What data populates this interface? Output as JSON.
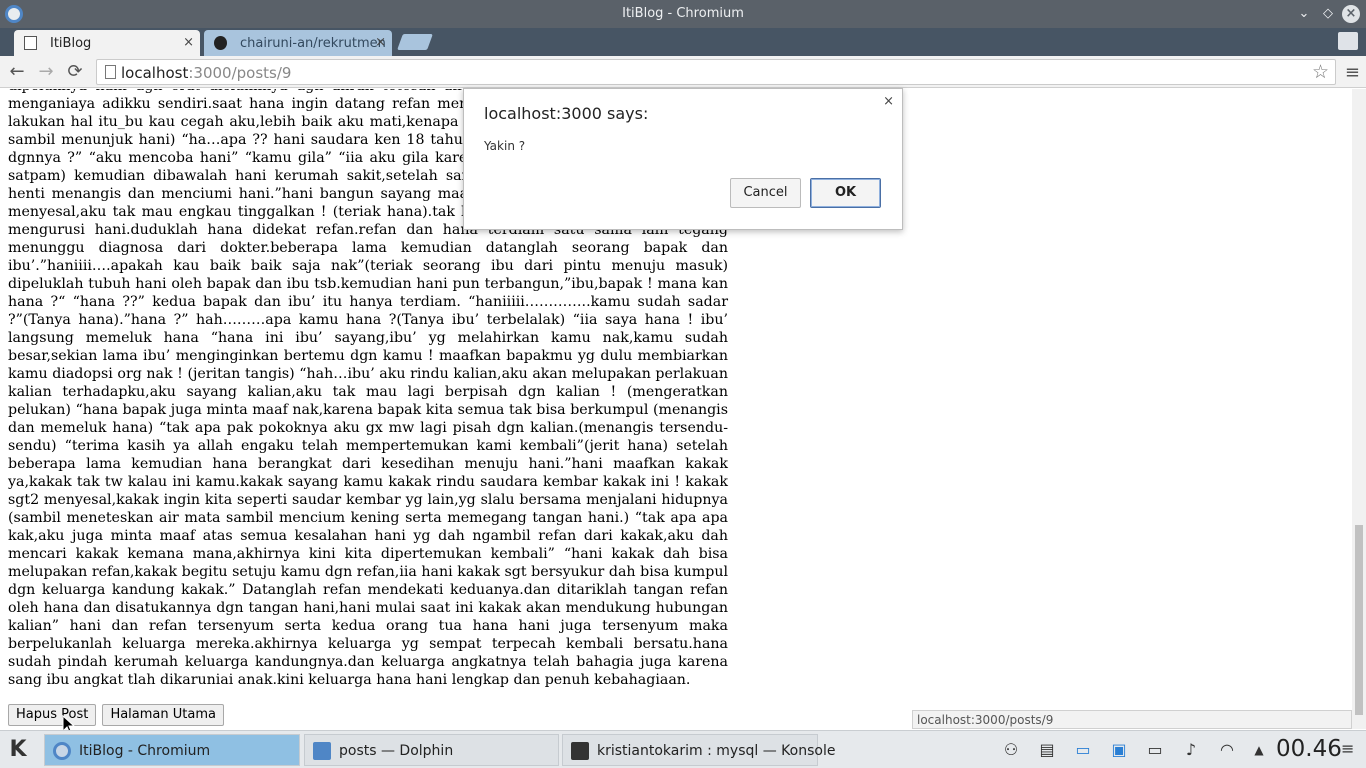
{
  "window": {
    "title": "ItiBlog - Chromium"
  },
  "tabs": [
    {
      "label": "ItiBlog",
      "close": "×"
    },
    {
      "label": "chairuni-an/rekrutmen",
      "close": "×"
    }
  ],
  "toolbar": {
    "back": "←",
    "forward": "→",
    "reload": "⟳",
    "url_host": "localhost",
    "url_path": ":3000/posts/9",
    "star": "☆",
    "menu": "≡"
  },
  "article": {
    "body": "dipeluknya hani dgn erat diciuminya dgn aliran tetesan air mata yg harus mati saja,aku tlah menganiaya adikku sendiri.saat hana ingin datang refan mencegahnya.”ada apa hana ? jgn kau lakukan hal itu_bu kau cegah aku,lebih baik aku mati,kenapa kau tak cerita kala ?”(memberontak sambil menunjuk hani) “ha…apa ?? hani saudara ken 18 tahun terpisahkan” “apa yg kau lakukan dgnnya ?” “aku mencoba hani” “kamu gila” “iia aku gila karena mu” “sudah sudah jgn bertengk satpam) kemudian dibawalah hani kerumah sakit,setelah sampai dirumah sakit hana tak henti henti menangis dan menciumi hani.”hani bangun sayang maafkan kakakmu ini sayang ! aku sgt menyesal,aku tak mau engkau tinggalkan ! (teriak hana).tak lama kemudian datanglah dokter yg mengurusi hani.duduklah hana didekat refan.refan dan hana terdiam satu sama lain tegang menunggu diagnosa dari dokter.beberapa lama kemudian datanglah seorang bapak dan ibu’.”haniiii….apakah kau baik baik saja nak”(teriak seorang ibu dari pintu menuju masuk) dipeluklah tubuh hani oleh bapak dan ibu tsb.kemudian hani pun terbangun,”ibu,bapak ! mana kan hana ?“ “hana ??” kedua bapak dan ibu’ itu hanya terdiam. “haniiiii…………..kamu sudah sadar ?”(Tanya hana).”hana ?” hah………apa kamu hana ?(Tanya ibu’ terbelalak) “iia saya hana ! ibu’ langsung memeluk hana “hana ini ibu’ sayang,ibu’ yg melahirkan kamu nak,kamu sudah besar,sekian lama ibu’ menginginkan bertemu dgn kamu ! maafkan bapakmu yg dulu membiarkan kamu diadopsi org nak ! (jeritan tangis) “hah…ibu’ aku rindu kalian,aku akan melupakan perlakuan kalian terhadapku,aku sayang kalian,aku tak mau lagi berpisah dgn kalian ! (mengeratkan pelukan) “hana bapak juga minta maaf nak,karena bapak kita semua tak bisa berkumpul (menangis dan memeluk hana) “tak apa pak pokoknya aku gx mw lagi pisah dgn kalian.(menangis tersendu-sendu) “terima kasih ya allah engaku telah mempertemukan kami kembali”(jerit hana) setelah beberapa lama kemudian hana berangkat dari kesedihan menuju hani.”hani maafkan kakak ya,kakak tak tw kalau ini kamu.kakak sayang kamu kakak rindu saudara kembar kakak ini ! kakak sgt2 menyesal,kakak ingin kita seperti saudar kembar yg lain,yg slalu bersama menjalani hidupnya (sambil meneteskan air mata sambil mencium kening serta memegang tangan hani.) “tak apa apa kak,aku juga minta maaf atas semua kesalahan hani yg dah ngambil refan dari kakak,aku dah mencari kakak kemana mana,akhirnya kini kita dipertemukan kembali” “hani kakak dah bisa melupakan refan,kakak begitu setuju kamu dgn refan,iia hani kakak sgt bersyukur dah bisa kumpul dgn keluarga kandung kakak.” Datanglah refan mendekati keduanya.dan ditariklah tangan refan oleh hana dan disatukannya dgn tangan hani,hani mulai saat ini kakak akan mendukung hubungan kalian” hani dan refan tersenyum serta kedua orang tua hana hani juga tersenyum maka berpelukanlah keluarga mereka.akhirnya keluarga yg sempat terpecah kembali bersatu.hana sudah pindah kerumah keluarga kandungnya.dan keluarga angkatnya telah bahagia juga karena sang ibu angkat tlah dikaruniai anak.kini keluarga hana hani lengkap dan penuh kebahagiaan."
  },
  "buttons": {
    "delete": "Hapus Post",
    "home": "Halaman Utama"
  },
  "status_bubble": "localhost:3000/posts/9",
  "dialog": {
    "title": "localhost:3000 says:",
    "close": "×",
    "message": "Yakin ?",
    "cancel": "Cancel",
    "ok": "OK"
  },
  "taskbar": {
    "kmenu": "K",
    "tasks": [
      {
        "label": "ItiBlog - Chromium"
      },
      {
        "label": "posts — Dolphin"
      },
      {
        "label": "kristiantokarim : mysql — Konsole"
      }
    ],
    "clock": "00.46",
    "tray_arrow": "▲",
    "tray_menu": "≡"
  }
}
